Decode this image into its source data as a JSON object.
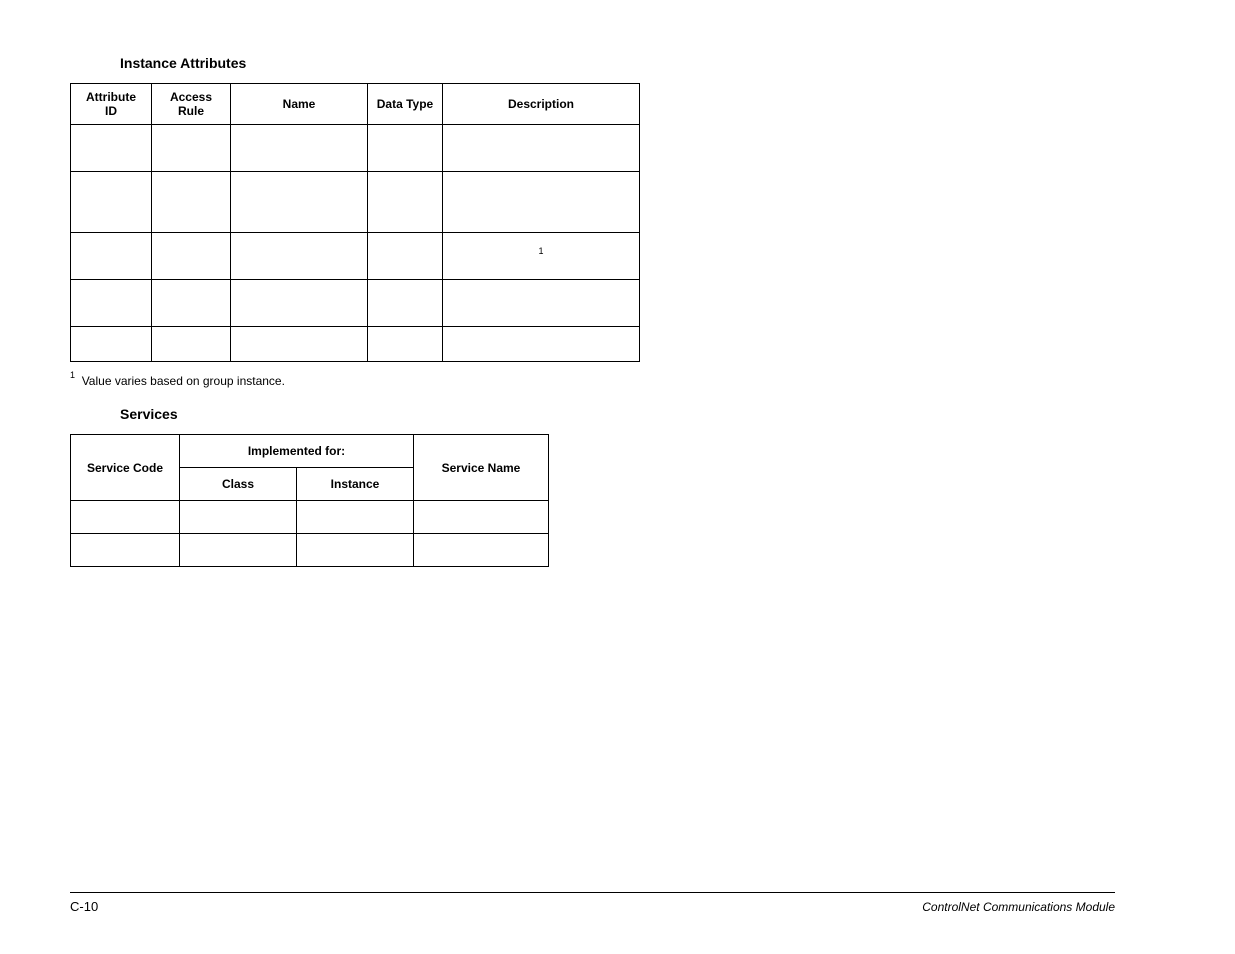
{
  "headings": {
    "instance_attributes": "Instance Attributes",
    "services": "Services"
  },
  "table1": {
    "headers": {
      "attribute_id": "Attribute ID",
      "access_rule": "Access Rule",
      "name": "Name",
      "data_type": "Data Type",
      "description": "Description"
    },
    "rows": [
      {
        "desc_sup": ""
      },
      {
        "desc_sup": ""
      },
      {
        "desc_sup": "1"
      },
      {
        "desc_sup": ""
      },
      {
        "desc_sup": ""
      }
    ]
  },
  "footnote": {
    "marker": "1",
    "text": "Value varies based on group instance."
  },
  "table2": {
    "group_header": "Implemented for:",
    "headers": {
      "service_code": "Service Code",
      "class": "Class",
      "instance": "Instance",
      "service_name": "Service Name"
    }
  },
  "footer": {
    "left": "C-10",
    "right": "ControlNet Communications Module"
  }
}
